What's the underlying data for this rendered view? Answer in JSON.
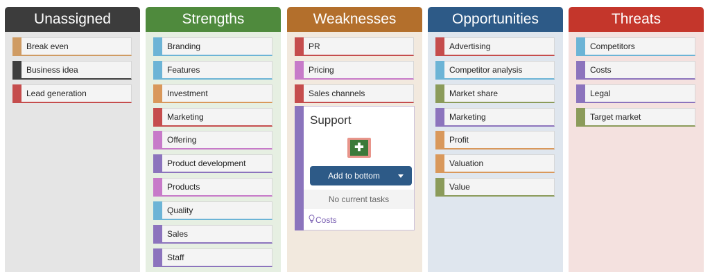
{
  "columns": [
    {
      "title": "Unassigned",
      "header_color": "#3c3c3c",
      "body_color": "#e5e5e5",
      "cards": [
        {
          "label": "Break even",
          "color": "#cf9b63"
        },
        {
          "label": "Business idea",
          "color": "#3f3f3f"
        },
        {
          "label": "Lead generation",
          "color": "#c54d4d"
        }
      ]
    },
    {
      "title": "Strengths",
      "header_color": "#4f8a3d",
      "body_color": "#e6efe2",
      "cards": [
        {
          "label": "Branding",
          "color": "#6cb4d6"
        },
        {
          "label": "Features",
          "color": "#6cb4d6"
        },
        {
          "label": "Investment",
          "color": "#d9985b"
        },
        {
          "label": "Marketing",
          "color": "#c54d4d"
        },
        {
          "label": "Offering",
          "color": "#c77ac9"
        },
        {
          "label": "Product development",
          "color": "#8c74bd"
        },
        {
          "label": "Products",
          "color": "#c77ac9"
        },
        {
          "label": "Quality",
          "color": "#6cb4d6"
        },
        {
          "label": "Sales",
          "color": "#8c74bd"
        },
        {
          "label": "Staff",
          "color": "#8c74bd"
        }
      ]
    },
    {
      "title": "Weaknesses",
      "header_color": "#b36f2c",
      "body_color": "#f2e9de",
      "cards": [
        {
          "label": "PR",
          "color": "#c54d4d"
        },
        {
          "label": "Pricing",
          "color": "#c77ac9"
        },
        {
          "label": "Sales channels",
          "color": "#c54d4d"
        }
      ],
      "expanded_card": {
        "title": "Support",
        "add_icon": "plus-icon",
        "add_button_label": "Add to bottom",
        "empty_text": "No current tasks",
        "tag_icon": "lightbulb-icon",
        "tag_label": "Costs"
      }
    },
    {
      "title": "Opportunities",
      "header_color": "#2d5a87",
      "body_color": "#dfe6ee",
      "cards": [
        {
          "label": "Advertising",
          "color": "#c54d4d"
        },
        {
          "label": "Competitor analysis",
          "color": "#6cb4d6"
        },
        {
          "label": "Market share",
          "color": "#8b9b5a"
        },
        {
          "label": "Marketing",
          "color": "#8c74bd"
        },
        {
          "label": "Profit",
          "color": "#d9985b"
        },
        {
          "label": "Valuation",
          "color": "#d9985b"
        },
        {
          "label": "Value",
          "color": "#8b9b5a"
        }
      ]
    },
    {
      "title": "Threats",
      "header_color": "#c4362b",
      "body_color": "#f4e1df",
      "cards": [
        {
          "label": "Competitors",
          "color": "#6cb4d6"
        },
        {
          "label": "Costs",
          "color": "#8c74bd"
        },
        {
          "label": "Legal",
          "color": "#8c74bd"
        },
        {
          "label": "Target market",
          "color": "#8b9b5a"
        }
      ]
    }
  ]
}
